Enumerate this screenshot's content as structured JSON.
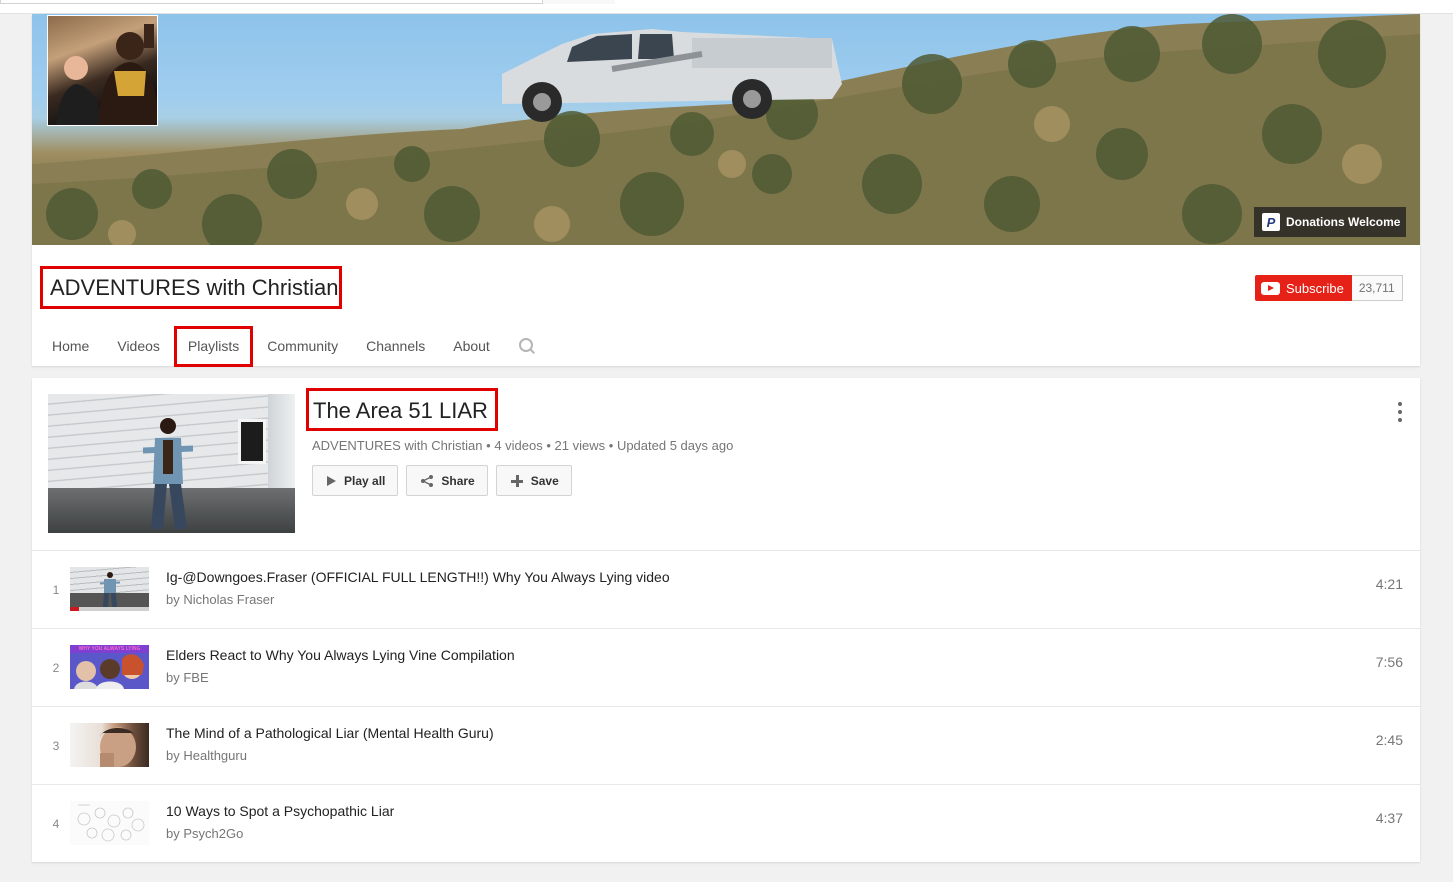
{
  "channel": {
    "name": "ADVENTURES with Christian",
    "donations_label": "Donations Welcome",
    "subscribe_label": "Subscribe",
    "subscriber_count": "23,711"
  },
  "tabs": [
    {
      "label": "Home"
    },
    {
      "label": "Videos"
    },
    {
      "label": "Playlists",
      "active": true
    },
    {
      "label": "Community"
    },
    {
      "label": "Channels"
    },
    {
      "label": "About"
    }
  ],
  "playlist": {
    "title": "The Area 51 LIAR",
    "owner": "ADVENTURES with Christian",
    "video_count": "4 videos",
    "views": "21 views",
    "updated": "Updated 5 days ago",
    "meta_separator": "•",
    "buttons": {
      "play_all": "Play all",
      "share": "Share",
      "save": "Save"
    }
  },
  "videos": [
    {
      "index": "1",
      "title": "Ig-@Downgoes.Fraser (OFFICIAL FULL LENGTH!!) Why You Always Lying video",
      "channel": "by Nicholas Fraser",
      "duration": "4:21"
    },
    {
      "index": "2",
      "title": "Elders React to Why You Always Lying Vine Compilation",
      "channel": "by FBE",
      "duration": "7:56"
    },
    {
      "index": "3",
      "title": "The Mind of a Pathological Liar (Mental Health Guru)",
      "channel": "by Healthguru",
      "duration": "2:45"
    },
    {
      "index": "4",
      "title": "10 Ways to Spot a Psychopathic Liar",
      "channel": "by Psych2Go",
      "duration": "4:37"
    }
  ],
  "thumbnail_text": {
    "video2_header": "WHY YOU ALWAYS LYING"
  },
  "icons": {
    "paypal": "P",
    "highlight_color": "#e10000",
    "subscribe_color": "#e62117"
  }
}
